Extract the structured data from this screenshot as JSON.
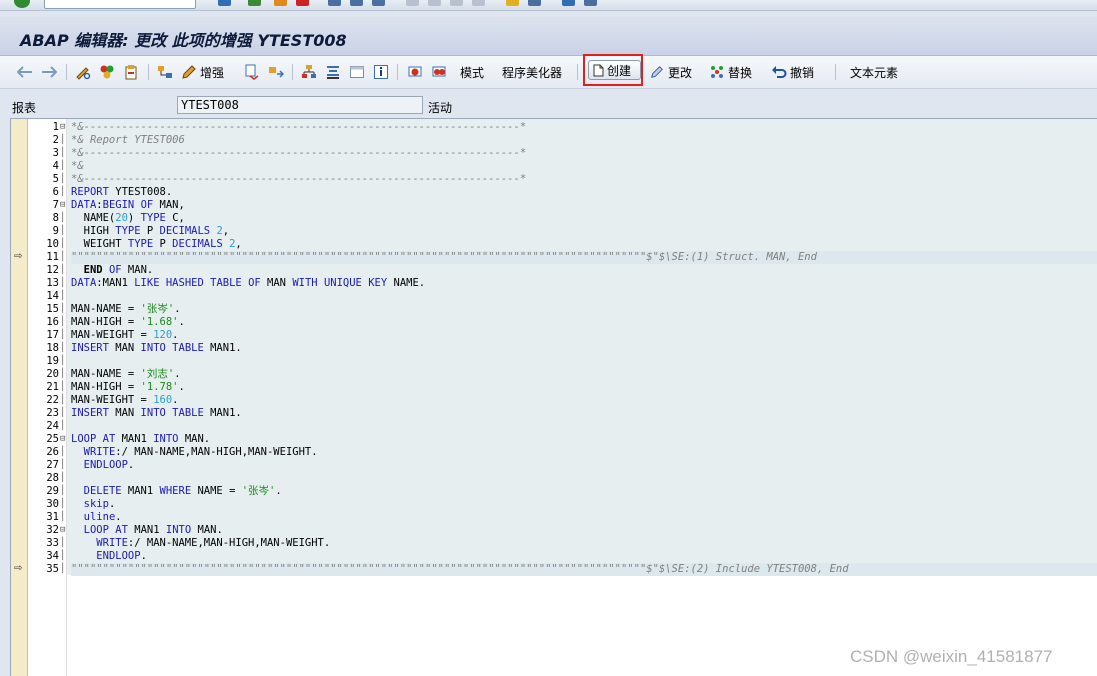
{
  "window": {
    "title": "ABAP 编辑器: 更改 此项的增强 YTEST008"
  },
  "toolbar": {
    "enhance_label": "增强",
    "pattern_label": "模式",
    "pretty_printer_label": "程序美化器",
    "create_label": "创建",
    "change_label": "更改",
    "replace_label": "替换",
    "undo_label": "撤销",
    "text_elements_label": "文本元素"
  },
  "header_fields": {
    "program_label": "报表",
    "program_value": "YTEST008",
    "status": "活动"
  },
  "code_lines": [
    {
      "n": "1",
      "text": "*&---------------------------------------------------------------------*"
    },
    {
      "n": "2",
      "text": "*& Report YTEST006"
    },
    {
      "n": "3",
      "text": "*&---------------------------------------------------------------------*"
    },
    {
      "n": "4",
      "text": "*&"
    },
    {
      "n": "5",
      "text": "*&---------------------------------------------------------------------*"
    },
    {
      "n": "6",
      "text": "REPORT YTEST008."
    },
    {
      "n": "7",
      "text": "DATA:BEGIN OF MAN,"
    },
    {
      "n": "8",
      "text": "  NAME(20) TYPE C,"
    },
    {
      "n": "9",
      "text": "  HIGH TYPE P DECIMALS 2,"
    },
    {
      "n": "10",
      "text": "  WEIGHT TYPE P DECIMALS 2,"
    },
    {
      "n": "11",
      "text": "\"\"\"\"\"\"\"\"\"\"\"\"\"\"\"\"\"\"\"\"\"\"\"\"\"\"\"\"\"\"\"\"\"\"\"\"\"\"\"\"\"\"\"\"\"\"\"\"\"\"\"\"\"\"\"\"\"\"\"\"\"\"\"\"\"\"\"\"\"\"\"\"\"\"\"\"\"\"\"\"\"\"\"\"\"\"\"\"\"\"\"$\"$\\SE:(1) Struct. MAN, End"
    },
    {
      "n": "12",
      "text": "  END OF MAN."
    },
    {
      "n": "13",
      "text": "DATA:MAN1 LIKE HASHED TABLE OF MAN WITH UNIQUE KEY NAME."
    },
    {
      "n": "14",
      "text": ""
    },
    {
      "n": "15",
      "text": "MAN-NAME = '张岑'."
    },
    {
      "n": "16",
      "text": "MAN-HIGH = '1.68'."
    },
    {
      "n": "17",
      "text": "MAN-WEIGHT = 120."
    },
    {
      "n": "18",
      "text": "INSERT MAN INTO TABLE MAN1."
    },
    {
      "n": "19",
      "text": ""
    },
    {
      "n": "20",
      "text": "MAN-NAME = '刘志'."
    },
    {
      "n": "21",
      "text": "MAN-HIGH = '1.78'."
    },
    {
      "n": "22",
      "text": "MAN-WEIGHT = 160."
    },
    {
      "n": "23",
      "text": "INSERT MAN INTO TABLE MAN1."
    },
    {
      "n": "24",
      "text": ""
    },
    {
      "n": "25",
      "text": "LOOP AT MAN1 INTO MAN."
    },
    {
      "n": "26",
      "text": "  WRITE:/ MAN-NAME,MAN-HIGH,MAN-WEIGHT."
    },
    {
      "n": "27",
      "text": "  ENDLOOP."
    },
    {
      "n": "28",
      "text": ""
    },
    {
      "n": "29",
      "text": "  DELETE MAN1 WHERE NAME = '张岑'."
    },
    {
      "n": "30",
      "text": "  skip."
    },
    {
      "n": "31",
      "text": "  uline."
    },
    {
      "n": "32",
      "text": "  LOOP AT MAN1 INTO MAN."
    },
    {
      "n": "33",
      "text": "    WRITE:/ MAN-NAME,MAN-HIGH,MAN-WEIGHT."
    },
    {
      "n": "34",
      "text": "    ENDLOOP."
    },
    {
      "n": "35",
      "text": "\"\"\"\"\"\"\"\"\"\"\"\"\"\"\"\"\"\"\"\"\"\"\"\"\"\"\"\"\"\"\"\"\"\"\"\"\"\"\"\"\"\"\"\"\"\"\"\"\"\"\"\"\"\"\"\"\"\"\"\"\"\"\"\"\"\"\"\"\"\"\"\"\"\"\"\"\"\"\"\"\"\"\"\"\"\"\"\"\"\"\"$\"$\\SE:(2) Include YTEST008, End"
    }
  ],
  "watermark": "CSDN @weixin_41581877",
  "colors": {
    "keyword": "#1a1ab8",
    "comment": "#808080",
    "string": "#1a8a1a",
    "number": "#2aa0d0",
    "highlight_frame": "#e02020"
  }
}
